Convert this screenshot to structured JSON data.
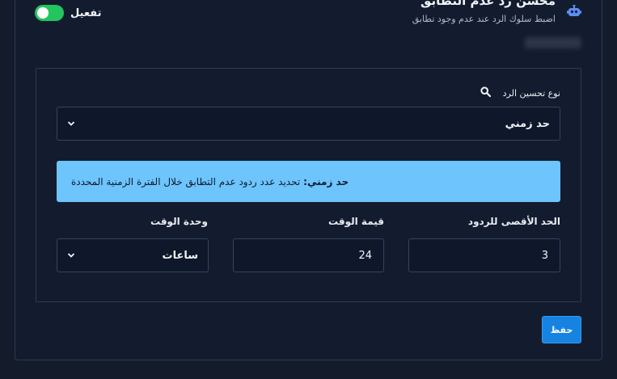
{
  "header": {
    "title": "محسّن رد عدم التطابق",
    "subtitle": "اضبط سلوك الرد عند عدم وجود تطابق",
    "icon": "robot-icon",
    "toggle_label": "تفعيل",
    "toggle_on": true,
    "accent": "#22c55e"
  },
  "form": {
    "type_label": "نوع تحسين الرد",
    "type_value": "حد زمني",
    "info_strong": "حد زمني:",
    "info_text": "تحديد عدد ردود عدم التطابق خلال الفترة الزمنية المحددة",
    "max_label": "الحد الأقصى للردود",
    "max_value": "3",
    "time_value_label": "قيمة الوقت",
    "time_value": "24",
    "unit_label": "وحدة الوقت",
    "unit_value": "ساعات",
    "info_color": "#6ec4fc"
  },
  "actions": {
    "save_label": "حفظ",
    "save_color": "#1683e3"
  }
}
